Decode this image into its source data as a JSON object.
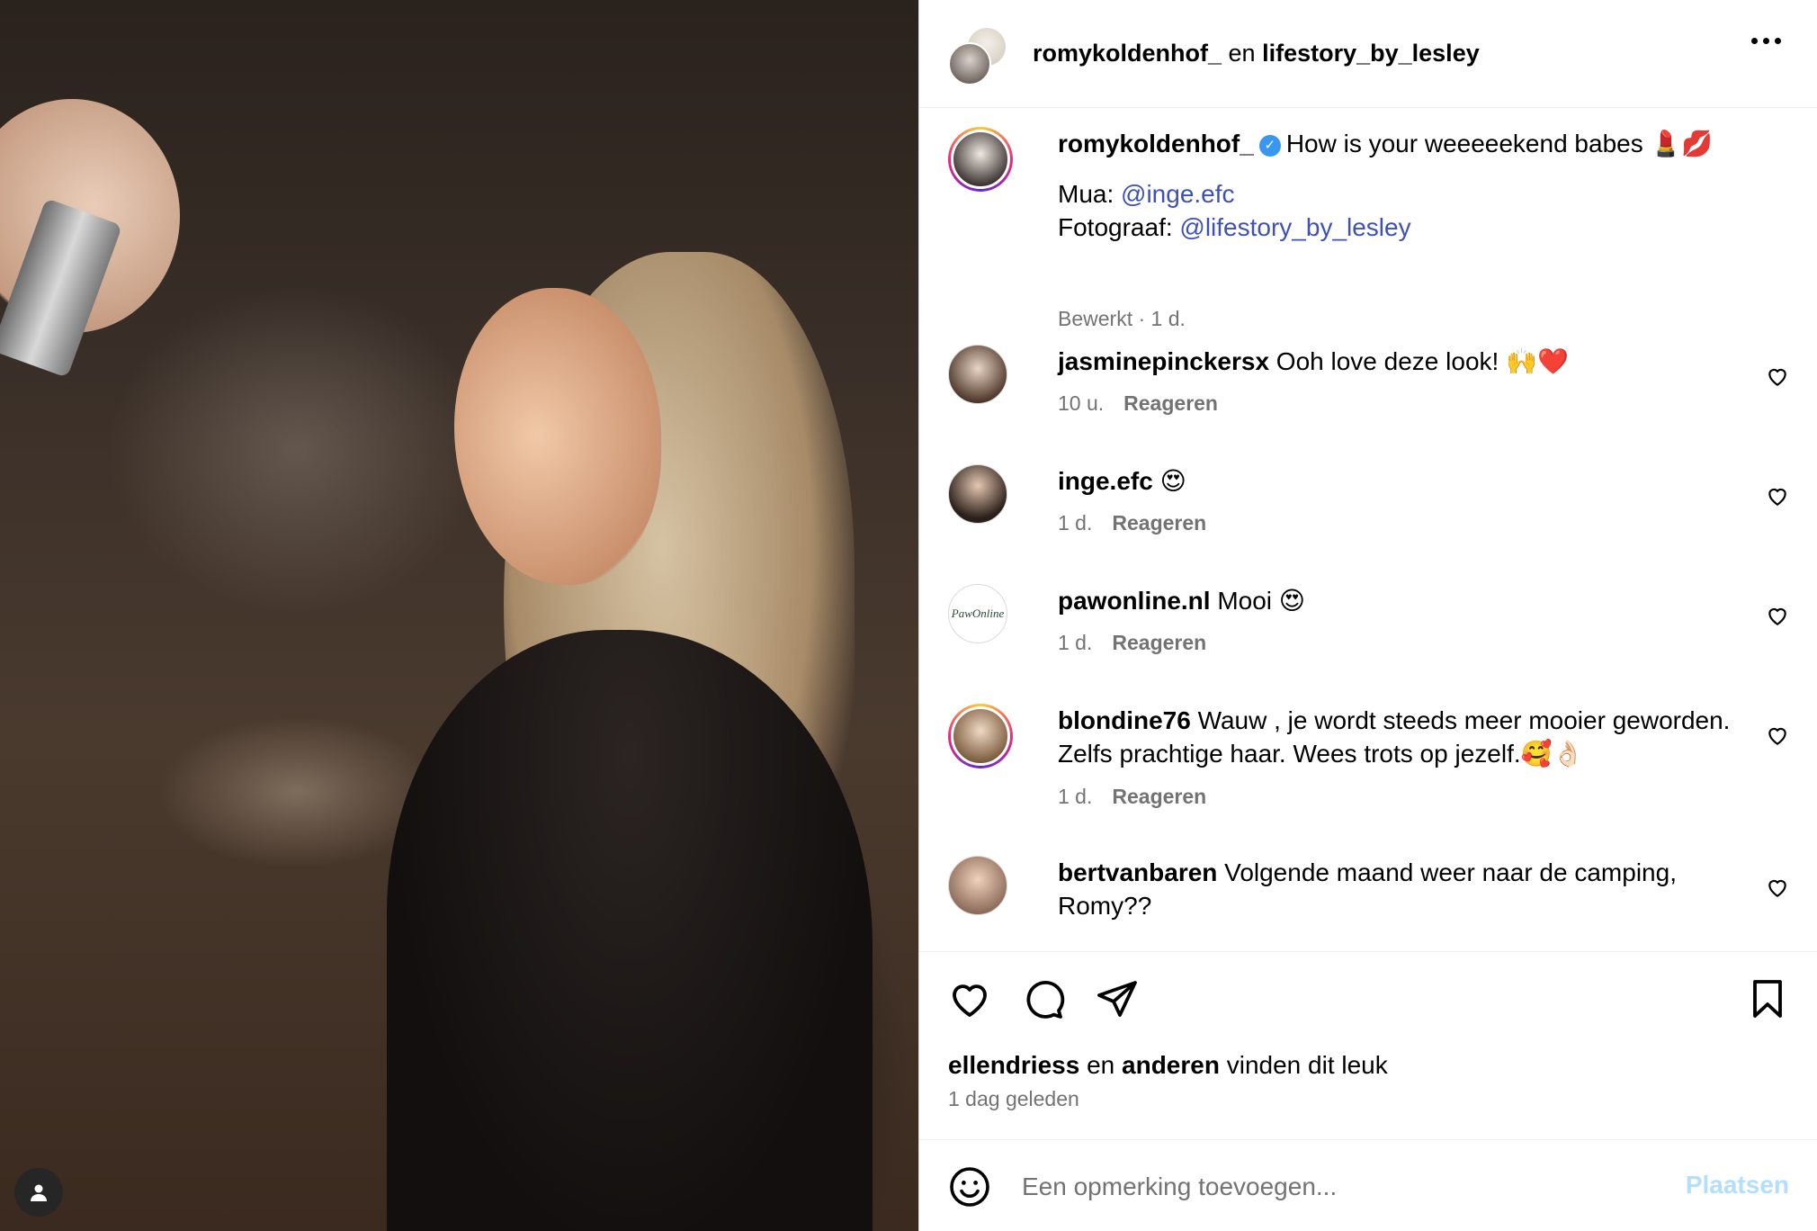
{
  "header": {
    "user1": "romykoldenhof_",
    "connector": " en ",
    "user2": "lifestory_by_lesley"
  },
  "caption": {
    "username": "romykoldenhof_",
    "text": "How is your weeeeekend babes 💄💋",
    "line2_label": "Mua: ",
    "line2_mention": "@inge.efc",
    "line3_label": "Fotograaf: ",
    "line3_mention": "@lifestory_by_lesley",
    "meta": "Bewerkt · 1 d."
  },
  "comments": [
    {
      "username": "jasminepinckersx",
      "text": " Ooh love deze look! 🙌❤️",
      "time": "10 u.",
      "reply": "Reageren"
    },
    {
      "username": "inge.efc",
      "text": " 😍",
      "time": "1 d.",
      "reply": "Reageren"
    },
    {
      "username": "pawonline.nl",
      "text": " Mooi 😍",
      "time": "1 d.",
      "reply": "Reageren",
      "avatar_text": "PawOnline"
    },
    {
      "username": "blondine76",
      "text": " Wauw , je wordt steeds meer mooier geworden. Zelfs prachtige haar. Wees trots op jezelf.🥰👌🏻",
      "time": "1 d.",
      "reply": "Reageren"
    },
    {
      "username": "bertvanbaren",
      "text": " Volgende maand weer naar de camping, Romy??",
      "time": "",
      "reply": ""
    }
  ],
  "likes": {
    "user": "ellendriess",
    "connector": " en ",
    "others": "anderen",
    "suffix": " vinden dit leuk"
  },
  "time_ago": "1 dag geleden",
  "add_comment": {
    "placeholder": "Een opmerking toevoegen...",
    "post_label": "Plaatsen"
  },
  "colors": {
    "link": "#3f51b5",
    "muted": "#737373",
    "post_disabled": "#b2dffc",
    "verified": "#3897f0"
  }
}
